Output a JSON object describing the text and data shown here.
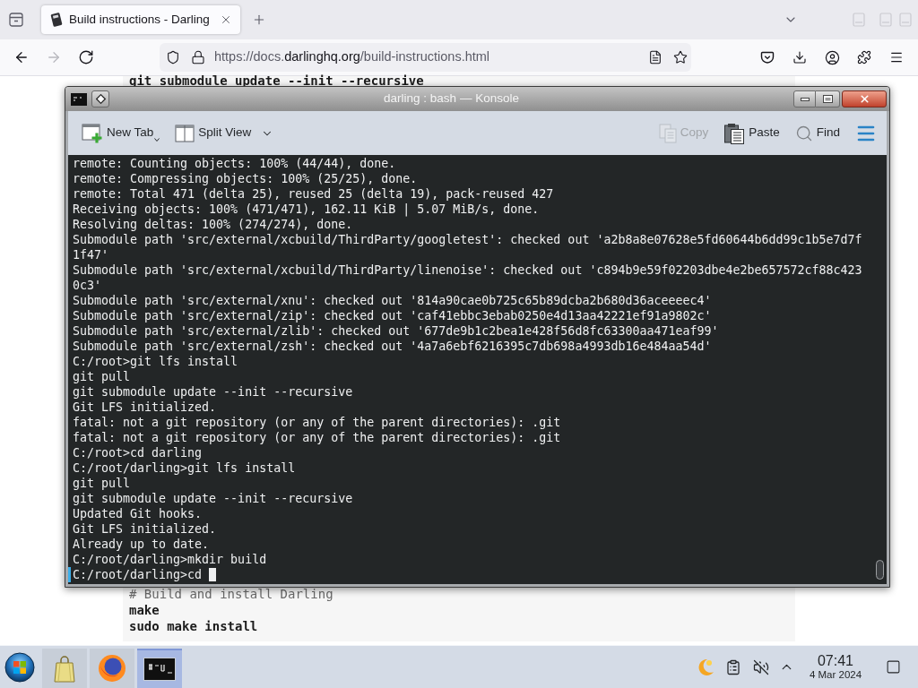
{
  "browser": {
    "tabs": [
      {
        "title": "Build instructions - Darling",
        "selected": true
      }
    ],
    "back": {
      "disabled": false
    },
    "forward": {
      "disabled": true
    },
    "url": {
      "prefix": "https://docs.",
      "domain": "darlinghq.org",
      "path": "/build-instructions.html"
    }
  },
  "page": {
    "code_top": [
      {
        "text": "git submodule update --init --recursive",
        "kind": "command"
      }
    ],
    "code_bottom": [
      {
        "text": "# Build and install Darling",
        "kind": "comment"
      },
      {
        "text": "make",
        "kind": "command"
      },
      {
        "text": "sudo make install",
        "kind": "command"
      }
    ]
  },
  "konsole": {
    "title": "darling : bash — Konsole",
    "toolbar_left": [
      {
        "kind": "new_tab",
        "label": "New Tab",
        "disabled": false
      },
      {
        "kind": "split_view",
        "label": "Split View",
        "disabled": false
      }
    ],
    "toolbar_right": [
      {
        "kind": "copy",
        "label": "Copy",
        "disabled": true
      },
      {
        "kind": "paste",
        "label": "Paste",
        "disabled": false
      },
      {
        "kind": "find",
        "label": "Find",
        "disabled": false
      }
    ],
    "lines": [
      "remote: Counting objects: 100% (44/44), done.",
      "remote: Compressing objects: 100% (25/25), done.",
      "remote: Total 471 (delta 25), reused 25 (delta 19), pack-reused 427",
      "Receiving objects: 100% (471/471), 162.11 KiB | 5.07 MiB/s, done.",
      "Resolving deltas: 100% (274/274), done.",
      "Submodule path 'src/external/xcbuild/ThirdParty/googletest': checked out 'a2b8a8e07628e5fd60644b6dd99c1b5e7d7f",
      "1f47'",
      "Submodule path 'src/external/xcbuild/ThirdParty/linenoise': checked out 'c894b9e59f02203dbe4e2be657572cf88c423",
      "0c3'",
      "Submodule path 'src/external/xnu': checked out '814a90cae0b725c65b89dcba2b680d36aceeeec4'",
      "Submodule path 'src/external/zip': checked out 'caf41ebbc3ebab0250e4d13aa42221ef91a9802c'",
      "Submodule path 'src/external/zlib': checked out '677de9b1c2bea1e428f56d8fc63300aa471eaf99'",
      "Submodule path 'src/external/zsh': checked out '4a7a6ebf6216395c7db698a4993db16e484aa54d'",
      "C:/root>git lfs install",
      "git pull",
      "git submodule update --init --recursive",
      "Git LFS initialized.",
      "fatal: not a git repository (or any of the parent directories): .git",
      "fatal: not a git repository (or any of the parent directories): .git",
      "C:/root>cd darling",
      "C:/root/darling>git lfs install",
      "git pull",
      "git submodule update --init --recursive",
      "Updated Git hooks.",
      "Git LFS initialized.",
      "Already up to date.",
      "C:/root/darling>mkdir build",
      "C:/root/darling>cd"
    ]
  },
  "taskbar": {
    "tasks": [
      {
        "kind": "files",
        "selected": false
      },
      {
        "kind": "browser",
        "selected": false
      },
      {
        "kind": "terminal",
        "selected": true
      }
    ],
    "clock": {
      "time": "07:41",
      "date": "4 Mar 2024"
    }
  }
}
